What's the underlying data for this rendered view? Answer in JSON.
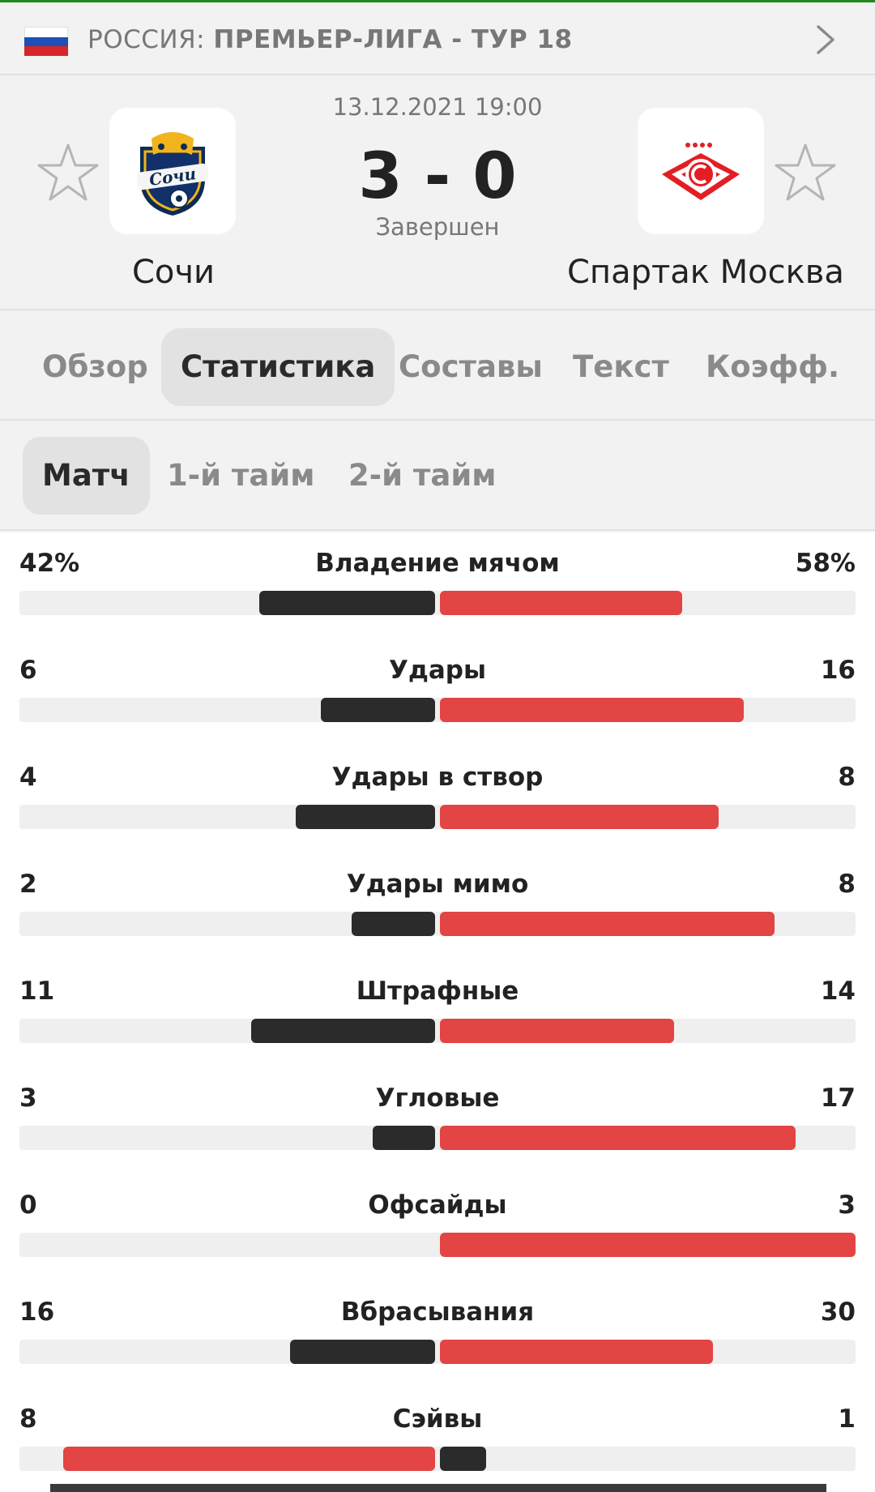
{
  "league": {
    "country": "РОССИЯ:",
    "name": "ПРЕМЬЕР-ЛИГА - ТУР 18",
    "flag_colors": [
      "#ffffff",
      "#1d4fb5",
      "#d6262b"
    ]
  },
  "match": {
    "datetime": "13.12.2021 19:00",
    "score": "3 - 0",
    "status": "Завершен",
    "home": {
      "name": "Сочи",
      "logo_text": "Сочи"
    },
    "away": {
      "name": "Спартак Москва"
    }
  },
  "tabs": [
    {
      "label": "Обзор",
      "active": false
    },
    {
      "label": "Статистика",
      "active": true
    },
    {
      "label": "Составы",
      "active": false
    },
    {
      "label": "Текст",
      "active": false
    },
    {
      "label": "Коэфф.",
      "active": false
    }
  ],
  "subtabs": [
    {
      "label": "Матч",
      "active": true
    },
    {
      "label": "1-й тайм",
      "active": false
    },
    {
      "label": "2-й тайм",
      "active": false
    }
  ],
  "colors": {
    "home_bar": "#2b2b2b",
    "away_bar": "#e34444",
    "track": "#efefef",
    "accent_line": "#1f8a1f"
  },
  "stats": [
    {
      "label": "Владение мячом",
      "home": "42%",
      "away": "58%",
      "home_val": 42,
      "away_val": 58
    },
    {
      "label": "Удары",
      "home": "6",
      "away": "16",
      "home_val": 6,
      "away_val": 16
    },
    {
      "label": "Удары в створ",
      "home": "4",
      "away": "8",
      "home_val": 4,
      "away_val": 8
    },
    {
      "label": "Удары мимо",
      "home": "2",
      "away": "8",
      "home_val": 2,
      "away_val": 8
    },
    {
      "label": "Штрафные",
      "home": "11",
      "away": "14",
      "home_val": 11,
      "away_val": 14
    },
    {
      "label": "Угловые",
      "home": "3",
      "away": "17",
      "home_val": 3,
      "away_val": 17
    },
    {
      "label": "Офсайды",
      "home": "0",
      "away": "3",
      "home_val": 0,
      "away_val": 3
    },
    {
      "label": "Вбрасывания",
      "home": "16",
      "away": "30",
      "home_val": 16,
      "away_val": 30
    },
    {
      "label": "Сэйвы",
      "home": "8",
      "away": "1",
      "home_val": 8,
      "away_val": 1
    }
  ]
}
